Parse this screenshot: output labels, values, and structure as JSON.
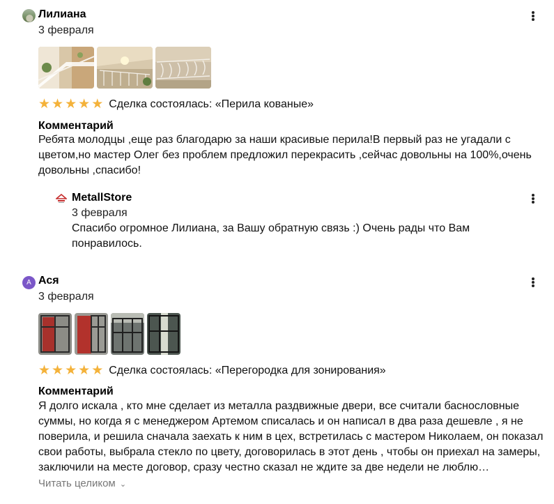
{
  "reviews": [
    {
      "author": "Лилиана",
      "date": "3 февраля",
      "rating": 5,
      "deal_text": "Сделка состоялась: «Перила кованые»",
      "comment_label": "Комментарий",
      "comment": "Ребята молодцы ,еще раз благодарю за наши красивые перила!В первый раз не угадали с цветом,но мастер Олег без проблем предложил перекрасить ,сейчас довольны на 100%,очень довольны ,спасибо!",
      "reply": {
        "author": "MetallStore",
        "date": "3 февраля",
        "text": "Спасибо огромное Лилиана, за Вашу обратную связь :) Очень рады что Вам понравилось."
      }
    },
    {
      "author": "Ася",
      "avatar_letter": "А",
      "date": "3 февраля",
      "rating": 5,
      "deal_text": "Сделка состоялась: «Перегородка для зонирования»",
      "comment_label": "Комментарий",
      "comment": "Я долго искала , кто мне сделает из металла раздвижные двери, все считали баснословные суммы, но когда я с менеджером Артемом списалась и он написал в два раза дешевле , я не поверила, и решила сначала заехать к ним в цех, встретилась с мастером Николаем, он показал свои работы, выбрала стекло по цвету, договорилась в этот день , чтобы он приехал на замеры, заключили на месте договор, сразу честно сказал не ждите за две недели не люблю…",
      "read_more": "Читать целиком"
    }
  ],
  "colors": {
    "star": "#f4b23a",
    "avatar_letter_bg": "#7b57c8"
  }
}
